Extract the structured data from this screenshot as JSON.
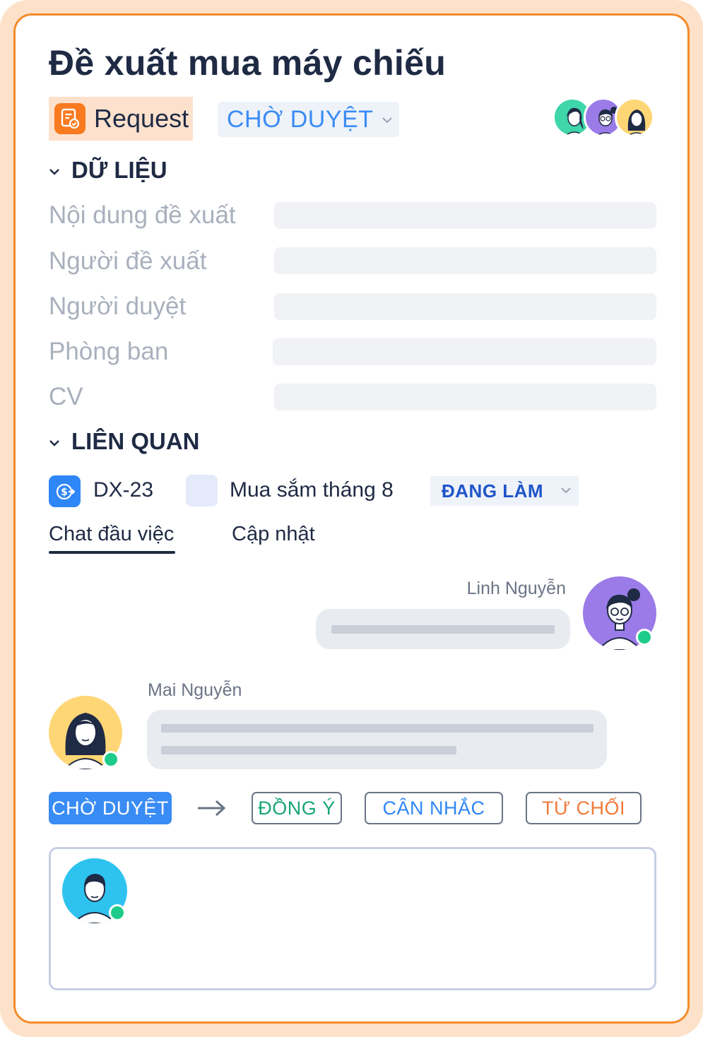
{
  "title": "Đề xuất mua máy chiếu",
  "type_chip": {
    "label": "Request",
    "icon": "request-doc-icon",
    "bg_color": "#fde1cc",
    "icon_color": "#f97a1f"
  },
  "status": {
    "label": "CHỜ DUYỆT",
    "color": "#3a8cf5"
  },
  "participants": [
    "participant-1",
    "participant-2",
    "participant-3"
  ],
  "data_section": {
    "heading": "DỮ LIỆU",
    "fields": [
      {
        "label": "Nội dung đề xuất",
        "value": ""
      },
      {
        "label": "Người đề xuất",
        "value": ""
      },
      {
        "label": "Người duyệt",
        "value": ""
      },
      {
        "label": "Phòng ban",
        "value": ""
      },
      {
        "label": "CV",
        "value": ""
      }
    ]
  },
  "related_section": {
    "heading": "LIÊN QUAN",
    "item": {
      "code": "DX-23",
      "icon": "money-transfer-icon",
      "name": "Mua sắm tháng 8",
      "status": "ĐANG LÀM",
      "status_color": "#1f55c9"
    }
  },
  "tabs": [
    {
      "label": "Chat đầu việc",
      "active": true
    },
    {
      "label": "Cập nhật",
      "active": false
    }
  ],
  "messages": [
    {
      "author": "Linh Nguyễn",
      "side": "right",
      "online": true
    },
    {
      "author": "Mai Nguyễn",
      "side": "left",
      "online": true
    }
  ],
  "workflow": {
    "current": "CHỜ DUYỆT",
    "arrow": "→",
    "actions": [
      {
        "label": "ĐỒNG Ý",
        "color": "#17a673"
      },
      {
        "label": "CÂN NHẮC",
        "color": "#2f86f6"
      },
      {
        "label": "TỪ CHỐI",
        "color": "#f07a3a"
      }
    ]
  },
  "composer": {
    "online": true
  },
  "colors": {
    "accent_orange": "#f58a2a",
    "online": "#1fcb8b",
    "primary_blue": "#3a8cf5"
  }
}
